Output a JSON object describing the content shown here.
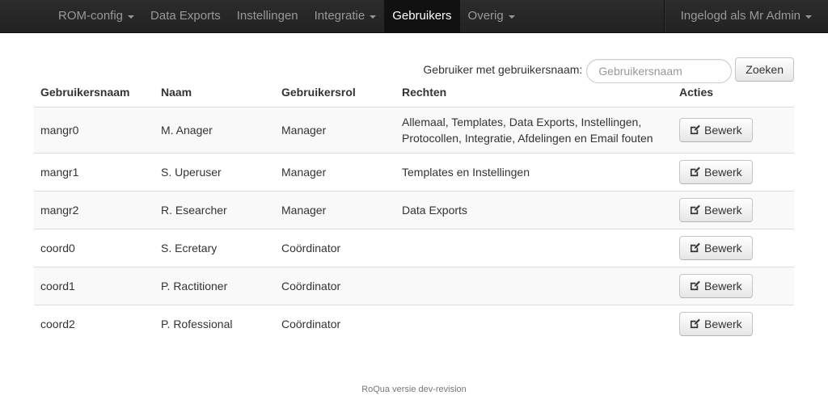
{
  "nav": {
    "left": [
      {
        "label": "ROM-config",
        "dropdown": true,
        "active": false
      },
      {
        "label": "Data Exports",
        "dropdown": false,
        "active": false
      },
      {
        "label": "Instellingen",
        "dropdown": false,
        "active": false
      },
      {
        "label": "Integratie",
        "dropdown": true,
        "active": false
      },
      {
        "label": "Gebruikers",
        "dropdown": false,
        "active": true
      },
      {
        "label": "Overig",
        "dropdown": true,
        "active": false
      }
    ],
    "user_menu": {
      "label": "Ingelogd als Mr Admin",
      "dropdown": true
    }
  },
  "search": {
    "label": "Gebruiker met gebruikersnaam:",
    "placeholder": "Gebruikersnaam",
    "value": "",
    "button_label": "Zoeken"
  },
  "table": {
    "headers": [
      "Gebruikersnaam",
      "Naam",
      "Gebruikersrol",
      "Rechten",
      "Acties"
    ],
    "edit_label": "Bewerk",
    "rows": [
      {
        "username": "mangr0",
        "name": "M. Anager",
        "role": "Manager",
        "rights": "Allemaal, Templates, Data Exports, Instellingen, Protocollen, Integratie, Afdelingen en Email fouten"
      },
      {
        "username": "mangr1",
        "name": "S. Uperuser",
        "role": "Manager",
        "rights": "Templates en Instellingen"
      },
      {
        "username": "mangr2",
        "name": "R. Esearcher",
        "role": "Manager",
        "rights": "Data Exports"
      },
      {
        "username": "coord0",
        "name": "S. Ecretary",
        "role": "Coördinator",
        "rights": ""
      },
      {
        "username": "coord1",
        "name": "P. Ractitioner",
        "role": "Coördinator",
        "rights": ""
      },
      {
        "username": "coord2",
        "name": "P. Rofessional",
        "role": "Coördinator",
        "rights": ""
      }
    ]
  },
  "footer": {
    "text": "RoQua versie dev-revision"
  },
  "icons": {
    "edit": "edit-icon",
    "caret": "chevron-down-icon"
  },
  "colors": {
    "navbar": "#222222",
    "nav_text": "#999999",
    "nav_active_bg": "#111111",
    "row_stripe": "#f9f9f9"
  }
}
